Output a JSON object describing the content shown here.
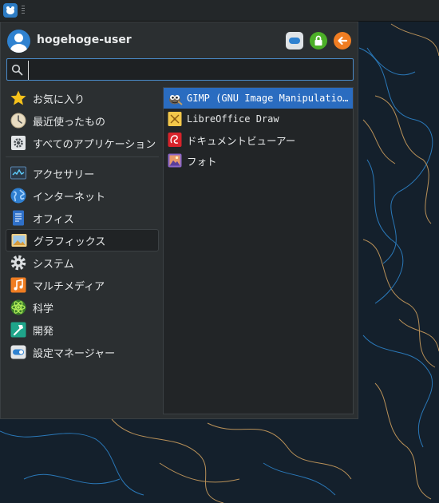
{
  "user": {
    "name": "hogehoge-user"
  },
  "search": {
    "value": "",
    "placeholder": ""
  },
  "categories": [
    {
      "label": "お気に入り",
      "icon": "star-icon"
    },
    {
      "label": "最近使ったもの",
      "icon": "clock-icon"
    },
    {
      "label": "すべてのアプリケーション",
      "icon": "gear-box-icon"
    },
    {
      "label": "アクセサリー",
      "icon": "monitor-icon"
    },
    {
      "label": "インターネット",
      "icon": "globe-icon"
    },
    {
      "label": "オフィス",
      "icon": "document-icon"
    },
    {
      "label": "グラフィックス",
      "icon": "picture-icon",
      "selected": true
    },
    {
      "label": "システム",
      "icon": "gear-icon"
    },
    {
      "label": "マルチメディア",
      "icon": "music-note-icon"
    },
    {
      "label": "科学",
      "icon": "atom-icon"
    },
    {
      "label": "開発",
      "icon": "hammer-icon"
    },
    {
      "label": "設定マネージャー",
      "icon": "toggle-icon"
    }
  ],
  "apps": [
    {
      "label": "GIMP (GNU Image Manipulation Program)",
      "icon": "gimp-icon",
      "selected": true
    },
    {
      "label": "LibreOffice Draw",
      "icon": "libreoffice-draw-icon"
    },
    {
      "label": "ドキュメントビューアー",
      "icon": "document-viewer-icon"
    },
    {
      "label": "フォト",
      "icon": "photos-icon"
    }
  ],
  "colors": {
    "accent": "#2a6cc0",
    "menu_bg": "#2b2f31",
    "desktop_bg": "#14202c"
  }
}
